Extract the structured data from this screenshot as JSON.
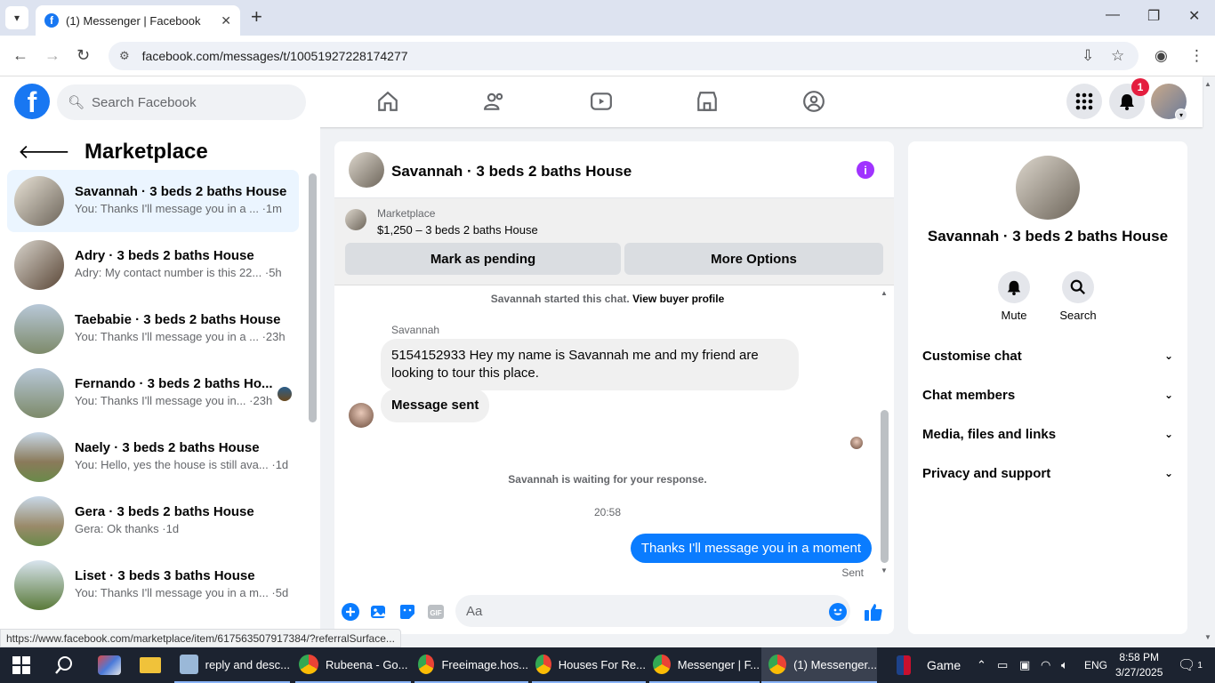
{
  "browser": {
    "tab_title": "(1) Messenger | Facebook",
    "url": "facebook.com/messages/t/10051927228174277",
    "status_url": "https://www.facebook.com/marketplace/item/617563507917384/?referralSurface..."
  },
  "fb": {
    "search_placeholder": "Search Facebook",
    "notif_count": "1"
  },
  "sidebar": {
    "title": "Marketplace",
    "conversations": [
      {
        "name": "Savannah · 3 beds 2 baths House",
        "snippet": "You: Thanks I'll message you in a ... ·1m",
        "active": true
      },
      {
        "name": "Adry · 3 beds 2 baths House",
        "snippet": "Adry: My contact number is this 22... ·5h"
      },
      {
        "name": "Taebabie · 3 beds 2 baths House",
        "snippet": "You: Thanks I'll message you in a ... ·23h"
      },
      {
        "name": "Fernando · 3 beds 2 baths Ho...",
        "snippet": "You: Thanks I'll message you in... ·23h"
      },
      {
        "name": "Naely · 3 beds 2 baths House",
        "snippet": "You: Hello, yes the house is still ava... ·1d"
      },
      {
        "name": "Gera · 3 beds 2 baths House",
        "snippet": "Gera: Ok thanks ·1d"
      },
      {
        "name": "Liset · 3 beds 3 baths House",
        "snippet": "You: Thanks I'll message you in a m... ·5d"
      }
    ]
  },
  "chat": {
    "title": "Savannah · 3 beds 2 baths House",
    "listing_label": "Marketplace",
    "listing_price": "$1,250 – 3 beds 2 baths House",
    "mark_pending": "Mark as pending",
    "more_options": "More Options",
    "started_text": "Savannah started this chat.",
    "view_profile": "View buyer profile",
    "sender_name": "Savannah",
    "msg1": "5154152933 Hey my name is Savannah me and my friend are looking to tour this place.",
    "msg2": "Message sent",
    "waiting": "Savannah is waiting for your response.",
    "time": "20:58",
    "reply": "Thanks I'll message you in a moment",
    "sent": "Sent",
    "input_placeholder": "Aa"
  },
  "info": {
    "name": "Savannah · 3 beds 2 baths House",
    "mute": "Mute",
    "search": "Search",
    "sections": [
      "Customise chat",
      "Chat members",
      "Media, files and links",
      "Privacy and support"
    ]
  },
  "taskbar": {
    "items": [
      "reply and desc...",
      "Rubeena - Go...",
      "Freeimage.hos...",
      "Houses For Re...",
      "Messenger | F...",
      "(1) Messenger..."
    ],
    "game": "Game",
    "lang": "ENG",
    "time": "8:58 PM",
    "date": "3/27/2025",
    "notif": "1"
  },
  "colors": {
    "fb_blue": "#1877f2",
    "messenger_blue": "#0a7cff",
    "info_purple": "#a033ff",
    "badge_red": "#e41e3f"
  }
}
